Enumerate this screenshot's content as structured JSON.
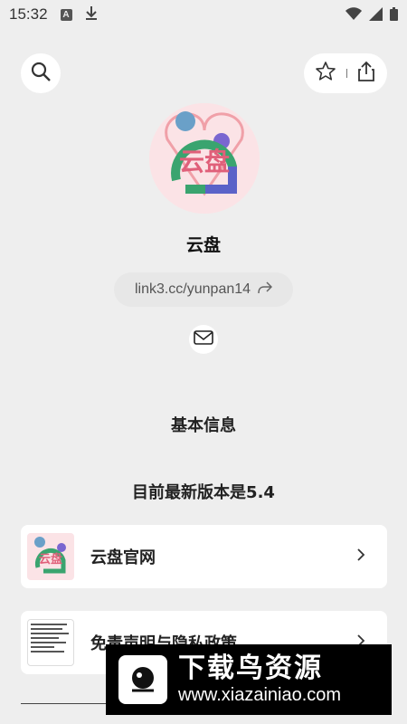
{
  "status_bar": {
    "time": "15:32",
    "notif_a": "A"
  },
  "profile": {
    "name": "云盘",
    "link": "link3.cc/yunpan14",
    "avatar_text": "云盘"
  },
  "sections": {
    "basic_info": "基本信息",
    "latest_version": "目前最新版本是5.4"
  },
  "cards": [
    {
      "label": "云盘官网",
      "thumb_text": "云盘"
    },
    {
      "label": "免责声明与隐私政策"
    }
  ],
  "watermark": {
    "title": "下载鸟资源",
    "url": "www.xiazainiao.com"
  },
  "colors": {
    "background": "#eeeeee",
    "card": "#ffffff",
    "accent_green": "#3aa46f",
    "accent_purple": "#6a5acd"
  }
}
